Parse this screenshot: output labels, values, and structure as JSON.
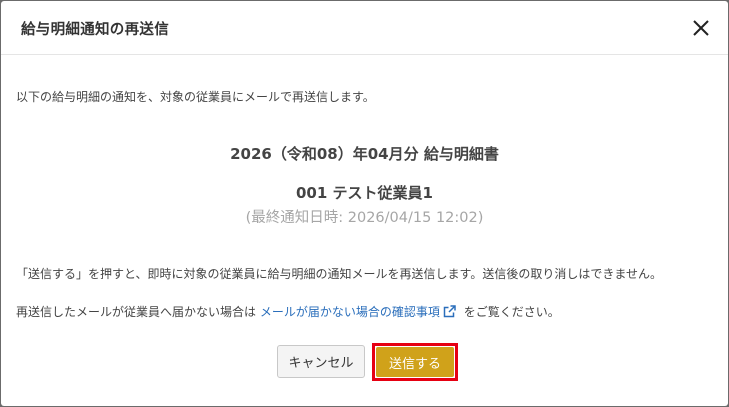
{
  "dialog": {
    "title": "給与明細通知の再送信",
    "intro": "以下の給与明細の通知を、対象の従業員にメールで再送信します。",
    "payslip_title": "2026（令和08）年04月分 給与明細書",
    "employee": "001 テスト従業員1",
    "last_notified": "(最終通知日時: 2026/04/15 12:02)",
    "notice": "「送信する」を押すと、即時に対象の従業員に給与明細の通知メールを再送信します。送信後の取り消しはできません。",
    "help_prefix": "再送信したメールが従業員へ届かない場合は",
    "help_link": "メールが届かない場合の確認事項",
    "help_suffix": "をご覧ください。",
    "cancel_label": "キャンセル",
    "send_label": "送信する",
    "icons": {
      "close": "close-icon",
      "external_link": "external-link-icon"
    },
    "colors": {
      "send_button": "#d0a21a",
      "highlight_outline": "#e60012",
      "link": "#2a6ebb"
    }
  }
}
